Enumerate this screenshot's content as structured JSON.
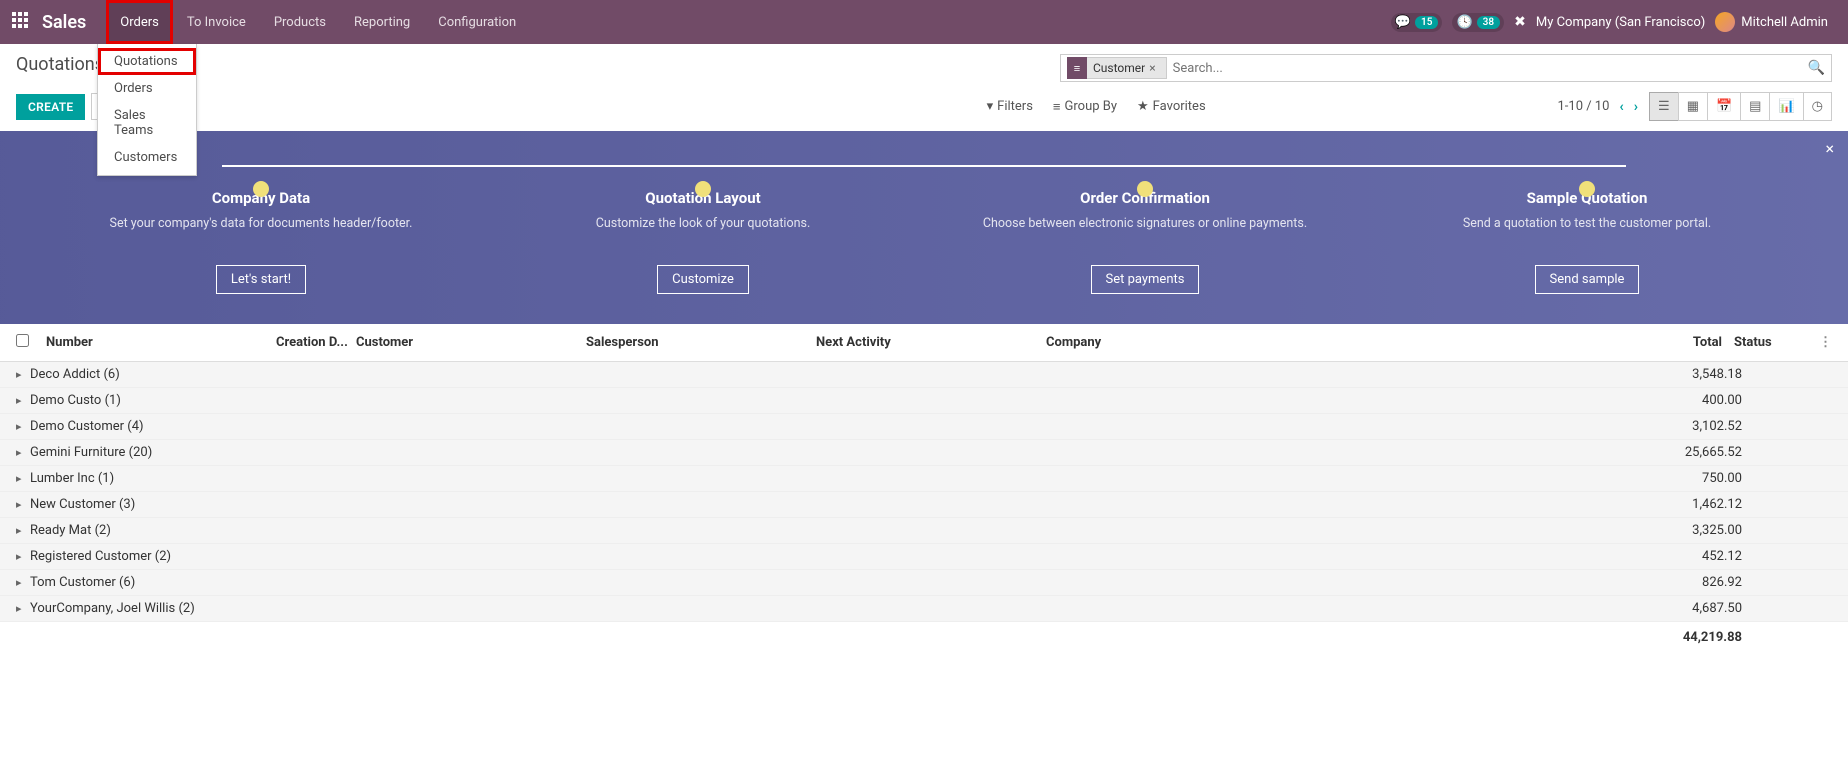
{
  "navbar": {
    "brand": "Sales",
    "menu": [
      "Orders",
      "To Invoice",
      "Products",
      "Reporting",
      "Configuration"
    ],
    "chat_count": "15",
    "activity_count": "38",
    "company": "My Company (San Francisco)",
    "user": "Mitchell Admin"
  },
  "orders_dropdown": [
    "Quotations",
    "Orders",
    "Sales Teams",
    "Customers"
  ],
  "breadcrumb": "Quotations",
  "buttons": {
    "create": "CREATE"
  },
  "search": {
    "facet_label": "Customer",
    "placeholder": "Search...",
    "filters": "Filters",
    "groupby": "Group By",
    "favorites": "Favorites"
  },
  "pager": {
    "range": "1-10 / 10"
  },
  "onboarding": {
    "steps": [
      {
        "title": "Company Data",
        "desc": "Set your company's data for documents header/footer.",
        "btn": "Let's start!"
      },
      {
        "title": "Quotation Layout",
        "desc": "Customize the look of your quotations.",
        "btn": "Customize"
      },
      {
        "title": "Order Confirmation",
        "desc": "Choose between electronic signatures or online payments.",
        "btn": "Set payments"
      },
      {
        "title": "Sample Quotation",
        "desc": "Send a quotation to test the customer portal.",
        "btn": "Send sample"
      }
    ]
  },
  "columns": {
    "number": "Number",
    "creation": "Creation D...",
    "customer": "Customer",
    "salesperson": "Salesperson",
    "next_activity": "Next Activity",
    "company": "Company",
    "total": "Total",
    "status": "Status"
  },
  "groups": [
    {
      "name": "Deco Addict (6)",
      "total": "3,548.18"
    },
    {
      "name": "Demo Custo (1)",
      "total": "400.00"
    },
    {
      "name": "Demo Customer (4)",
      "total": "3,102.52"
    },
    {
      "name": "Gemini Furniture (20)",
      "total": "25,665.52"
    },
    {
      "name": "Lumber Inc (1)",
      "total": "750.00"
    },
    {
      "name": "New Customer (3)",
      "total": "1,462.12"
    },
    {
      "name": "Ready Mat (2)",
      "total": "3,325.00"
    },
    {
      "name": "Registered Customer (2)",
      "total": "452.12"
    },
    {
      "name": "Tom Customer (6)",
      "total": "826.92"
    },
    {
      "name": "YourCompany, Joel Willis (2)",
      "total": "4,687.50"
    }
  ],
  "grand_total": "44,219.88"
}
